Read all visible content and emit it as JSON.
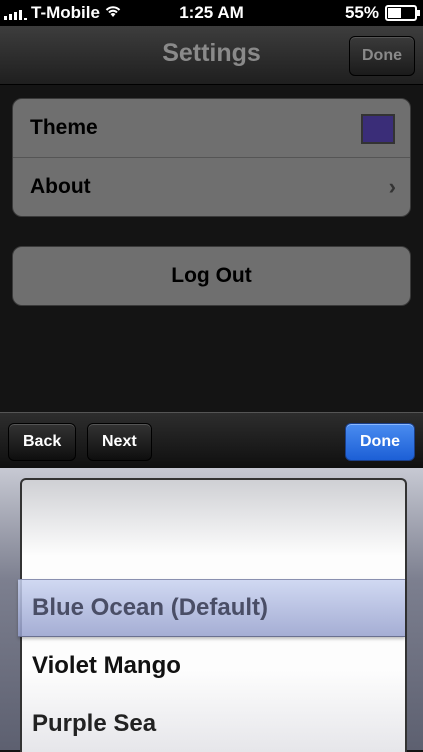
{
  "status_bar": {
    "carrier": "T-Mobile",
    "time": "1:25 AM",
    "battery_percent": "55%",
    "battery_level": 0.55
  },
  "nav": {
    "title": "Settings",
    "done_label": "Done"
  },
  "settings": {
    "theme_label": "Theme",
    "theme_swatch_color": "#3a2d78",
    "about_label": "About",
    "logout_label": "Log Out"
  },
  "toolbar": {
    "back_label": "Back",
    "next_label": "Next",
    "done_label": "Done"
  },
  "picker": {
    "selected": "Blue Ocean (Default)",
    "options": [
      "Blue Ocean (Default)",
      "Violet Mango",
      "Purple Sea"
    ]
  }
}
